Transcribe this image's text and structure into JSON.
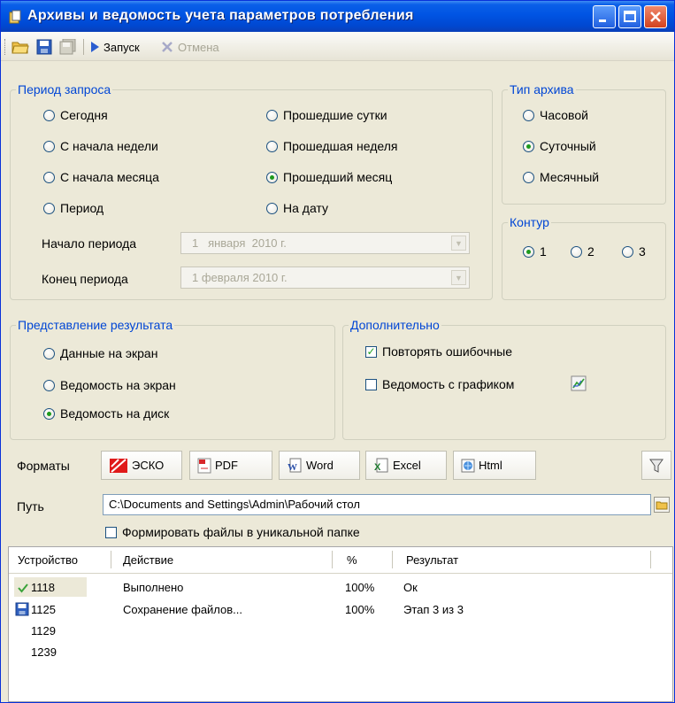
{
  "window": {
    "title": "Архивы и ведомость учета параметров потребления"
  },
  "toolbar": {
    "run_label": "Запуск",
    "cancel_label": "Отмена"
  },
  "period": {
    "legend": "Период запроса",
    "options": [
      "Сегодня",
      "Прошедшие сутки",
      "С начала недели",
      "Прошедшая неделя",
      "С начала месяца",
      "Прошедший месяц",
      "Период",
      "На дату"
    ],
    "selected": "Прошедший месяц",
    "start_label": "Начало периода",
    "start_value": "1   января  2010 г.",
    "end_label": "Конец периода",
    "end_value": "1 февраля 2010 г."
  },
  "archive_type": {
    "legend": "Тип архива",
    "options": [
      "Часовой",
      "Суточный",
      "Месячный"
    ],
    "selected": "Суточный"
  },
  "contour": {
    "legend": "Контур",
    "options": [
      "1",
      "2",
      "3"
    ],
    "selected": "1"
  },
  "result": {
    "legend": "Представление результата",
    "options": [
      "Данные на экран",
      "Ведомость на экран",
      "Ведомость на диск"
    ],
    "selected": "Ведомость на диск"
  },
  "extra": {
    "legend": "Дополнительно",
    "repeat_errors": "Повторять ошибочные",
    "repeat_checked": true,
    "with_chart": "Ведомость с графиком",
    "chart_checked": false
  },
  "formats": {
    "label": "Форматы",
    "buttons": [
      "ЭСКО",
      "PDF",
      "Word",
      "Excel",
      "Html"
    ]
  },
  "path": {
    "label": "Путь",
    "value": "C:\\Documents and Settings\\Admin\\Рабочий стол",
    "unique_folder": "Формировать файлы в уникальной папке"
  },
  "table": {
    "headers": [
      "Устройство",
      "Действие",
      "%",
      "Результат"
    ],
    "rows": [
      {
        "device": "1118",
        "action": "Выполнено",
        "percent": "100%",
        "result": "Ок",
        "icon": "check-icon"
      },
      {
        "device": "1125",
        "action": "Сохранение файлов...",
        "percent": "100%",
        "result": "Этап 3 из 3",
        "icon": "save-icon"
      },
      {
        "device": "1129",
        "action": "",
        "percent": "",
        "result": "",
        "icon": ""
      },
      {
        "device": "1239",
        "action": "",
        "percent": "",
        "result": "",
        "icon": ""
      }
    ]
  },
  "colors": {
    "legend_blue": "#0046d5",
    "titlebar_blue": "#0054e3",
    "check_green": "#1e9a1e"
  }
}
